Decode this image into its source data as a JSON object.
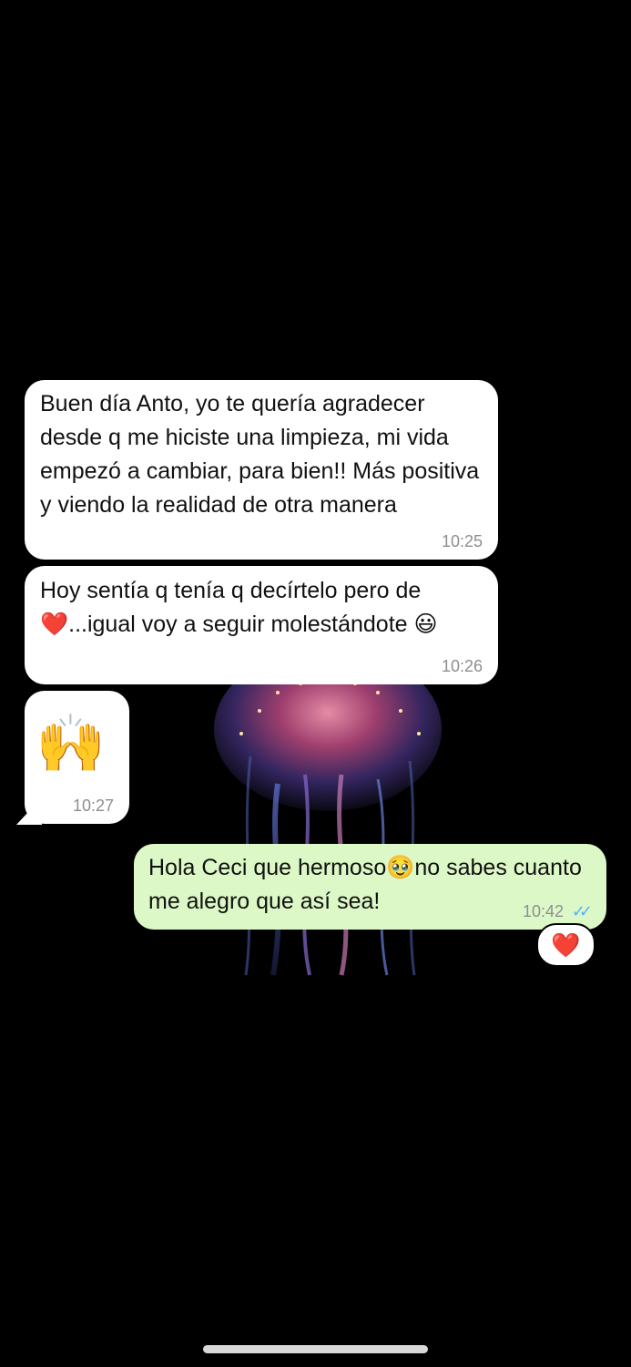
{
  "chat": {
    "messages": [
      {
        "direction": "incoming",
        "text": "Buen día Anto, yo te quería agradecer desde q me hiciste una limpieza, mi vida empezó a cambiar, para bien!! Más positiva y viendo la realidad de otra manera",
        "time": "10:25"
      },
      {
        "direction": "incoming",
        "text": "Hoy sentía q tenía q decírtelo pero de ❤️...igual voy a seguir molestándote 😃",
        "time": "10:26"
      },
      {
        "direction": "incoming",
        "emoji": "🙌",
        "time": "10:27"
      },
      {
        "direction": "outgoing",
        "text": "Hola Ceci que hermoso🥹no sabes cuanto me alegro que así sea!",
        "time": "10:42",
        "status": "read",
        "status_glyph": "✓✓",
        "reaction": "❤️"
      }
    ]
  },
  "colors": {
    "background": "#000000",
    "incoming_bubble": "#ffffff",
    "outgoing_bubble": "#dcf8c6",
    "read_ticks": "#4fb3ff",
    "timestamp": "#8e8e93"
  }
}
